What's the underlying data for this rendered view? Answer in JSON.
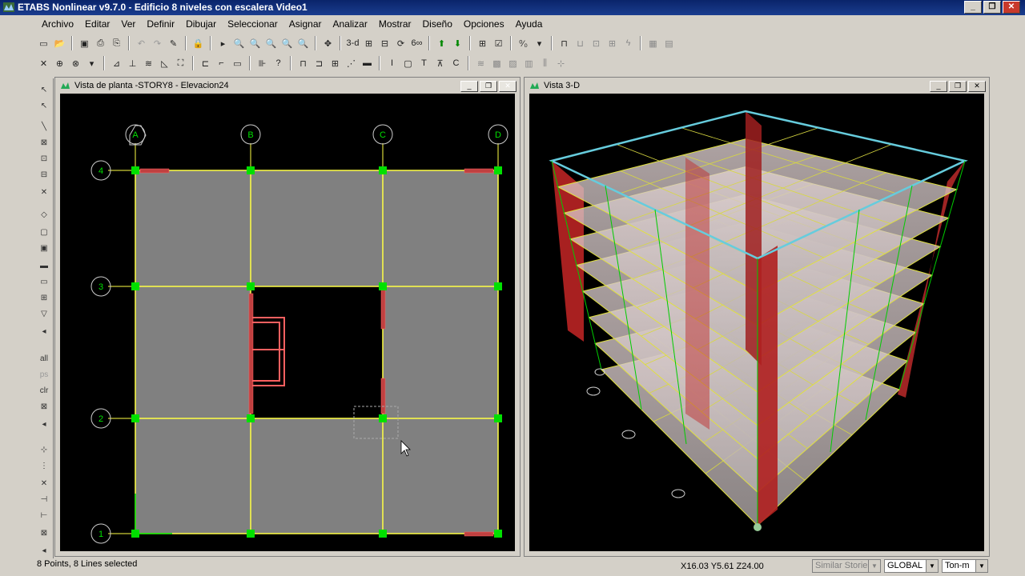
{
  "window": {
    "title": "ETABS Nonlinear v9.7.0 - Edificio 8 niveles con escalera Video1"
  },
  "menu": [
    "Archivo",
    "Editar",
    "Ver",
    "Definir",
    "Dibujar",
    "Seleccionar",
    "Asignar",
    "Analizar",
    "Mostrar",
    "Diseño",
    "Opciones",
    "Ayuda"
  ],
  "toolbar1": [
    "new-icon",
    "open-icon",
    "save-icon",
    "print-icon",
    "undo-icon",
    "redo-icon",
    "pencil-icon",
    "lock-icon",
    "run-icon",
    "zoom-in-icon",
    "zoom-out-icon",
    "zoom-window-icon",
    "zoom-all-icon",
    "pan-icon",
    "refresh-icon",
    "3d-view-icon",
    "plan-view-icon",
    "elevation-view-icon",
    "rotate-icon",
    "perspective-icon",
    "up-arrow-icon",
    "down-arrow-icon",
    "grid-icon",
    "check-icon",
    "percent-icon",
    "frame-icon",
    "shell-icon",
    "joint-icon",
    "lightning-icon",
    "table-icon",
    "options-icon"
  ],
  "toolbar1_labels": {
    "three_d": "3-d",
    "sixty": "6∞",
    "percent": "⁰⁄₀"
  },
  "toolbar2": [
    "select-icon",
    "pointer-icon",
    "joint-snap-icon",
    "line-snap-icon",
    "cursor-icon",
    "assign-icon",
    "restraint-icon",
    "spring-icon",
    "diaphragm-icon",
    "section-icon",
    "frame-release-icon",
    "link-icon",
    "wall-icon",
    "opening-icon",
    "load-icon",
    "question-icon",
    "beam-icon",
    "column-icon",
    "brace-icon",
    "slab-icon",
    "I-section-icon",
    "box-icon",
    "T-section-icon",
    "channel-icon",
    "C-section-icon",
    "wind-icon",
    "quake-icon",
    "mass-icon",
    "sheet-icon",
    "comb-icon"
  ],
  "left_pane": {
    "title": "Vista de planta -STORY8 - Elevacion24",
    "grid_cols": [
      "A",
      "B",
      "C",
      "D"
    ],
    "grid_rows": [
      "4",
      "3",
      "2",
      "1"
    ]
  },
  "right_pane": {
    "title": "Vista 3-D"
  },
  "left_toolbar": [
    "select-arrow-icon",
    "pointer-select-icon",
    "draw-line-icon",
    "draw-beam-icon",
    "draw-brace-icon",
    "draw-column-icon",
    "delete-x-icon",
    "draw-area-icon",
    "draw-rect-icon",
    "draw-point-icon",
    "draw-wall-icon",
    "draw-opening-icon",
    "draw-grid-icon",
    "draw-slab-icon",
    "all-select-icon",
    "ps-select-icon",
    "clr-select-icon",
    "intersect-icon",
    "snap-joint-icon",
    "snap-mid-icon",
    "snap-intersect-icon",
    "snap-perp-icon",
    "snap-line-icon",
    "snap-grid-icon",
    "snap-extra-icon"
  ],
  "left_toolbar_labels": {
    "all": "all",
    "ps": "ps",
    "clr": "clr"
  },
  "status": {
    "message": "8 Points, 8 Lines selected",
    "coords": "X16.03  Y5.61  Z24.00",
    "stories": "Similar Stories",
    "coord_sys": "GLOBAL",
    "units": "Ton-m"
  },
  "colors": {
    "title_bar": "#0a246a",
    "slab": "#808080",
    "grid_line": "#ffff00",
    "joint": "#00e000",
    "wall": "#b02020",
    "roof": "#66ccdd",
    "canvas": "#000000"
  }
}
